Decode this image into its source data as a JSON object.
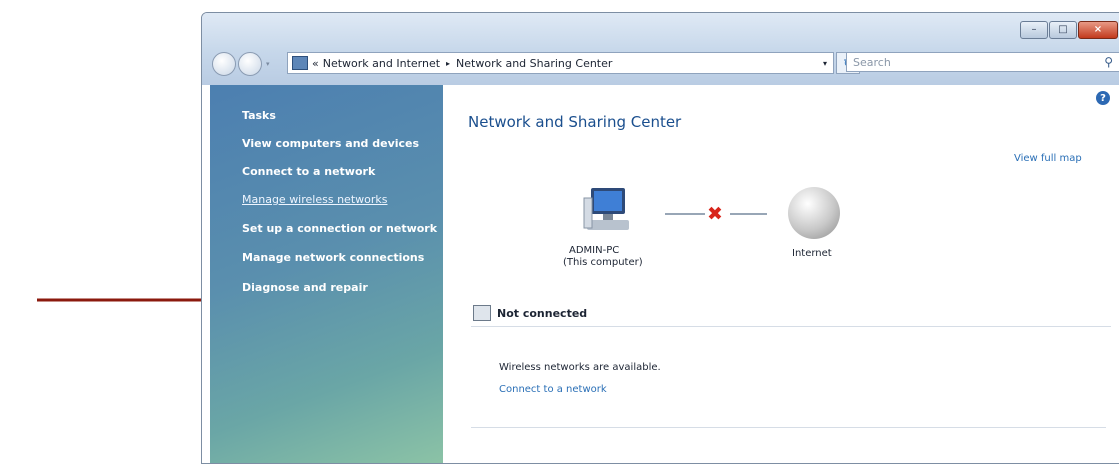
{
  "address_bar": {
    "chevron": "«",
    "segments": [
      "Network and Internet",
      "Network and Sharing Center"
    ],
    "separator": "▸",
    "dropdown": "▾"
  },
  "search": {
    "placeholder": "Search"
  },
  "refresh_glyph": "↻",
  "window_buttons": {
    "minimize": "–",
    "maximize": "□",
    "close": "×"
  },
  "sidebar": {
    "heading": "Tasks",
    "items": [
      {
        "label": "View computers and devices"
      },
      {
        "label": "Connect to a network"
      },
      {
        "label": "Manage wireless networks"
      },
      {
        "label": "Set up a connection or network"
      },
      {
        "label": "Manage network connections"
      },
      {
        "label": "Diagnose and repair"
      }
    ]
  },
  "main": {
    "title": "Network and Sharing Center",
    "view_full_map": "View full map",
    "map": {
      "computer_name": "ADMIN-PC",
      "computer_caption": "(This computer)",
      "internet_label": "Internet",
      "status_mark": "✖"
    },
    "status": "Not connected",
    "info": "Wireless networks are available.",
    "connect_link": "Connect to a network",
    "help": "?"
  },
  "colors": {
    "arrow": "#8b1a0e",
    "sidebar": "#4c7fb0",
    "link": "#2a6fb6",
    "error_x": "#d8241a"
  },
  "icons": [
    "computer-icon",
    "globe-icon",
    "network-status-icon",
    "help-icon",
    "search-icon",
    "refresh-icon",
    "back-icon",
    "forward-icon",
    "arrow-icon"
  ]
}
